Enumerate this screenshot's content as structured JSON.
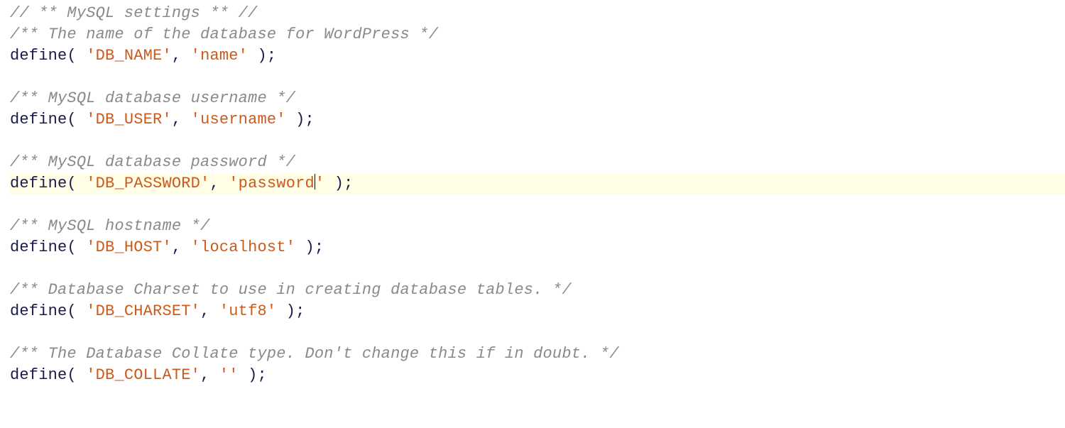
{
  "code": {
    "header_comment": "// ** MySQL settings ** //",
    "keyword_define": "define",
    "open": "( ",
    "sep": ", ",
    "close": " );",
    "blocks": [
      {
        "comment": "/** The name of the database for WordPress */",
        "key": "'DB_NAME'",
        "value": "'name'"
      },
      {
        "comment": "/** MySQL database username */",
        "key": "'DB_USER'",
        "value": "'username'"
      },
      {
        "comment": "/** MySQL database password */",
        "key": "'DB_PASSWORD'",
        "value_pre": "'password",
        "value_post": "'",
        "caret": true,
        "highlight": true
      },
      {
        "comment": "/** MySQL hostname */",
        "key": "'DB_HOST'",
        "value": "'localhost'"
      },
      {
        "comment": "/** Database Charset to use in creating database tables. */",
        "key": "'DB_CHARSET'",
        "value": "'utf8'"
      },
      {
        "comment": "/** The Database Collate type. Don't change this if in doubt. */",
        "key": "'DB_COLLATE'",
        "value": "''"
      }
    ]
  }
}
